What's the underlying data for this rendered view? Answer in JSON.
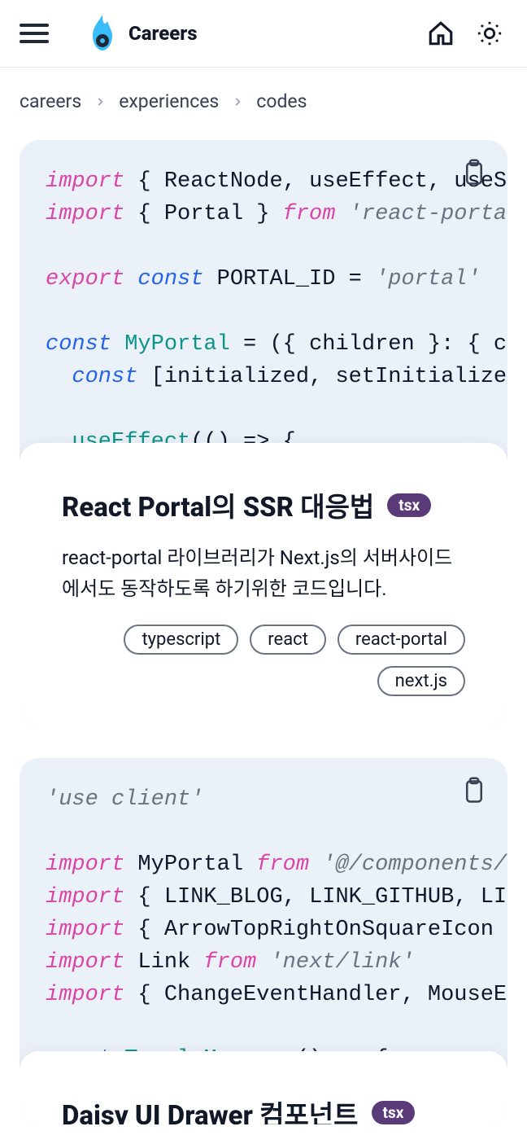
{
  "header": {
    "brand": "Careers"
  },
  "breadcrumb": {
    "items": [
      "careers",
      "experiences",
      "codes"
    ]
  },
  "cards": [
    {
      "title": "React Portal의 SSR 대응법",
      "lang_badge": "tsx",
      "description": "react-portal 라이브러리가 Next.js의 서버사이드에서도 동작하도록 하기위한 코드입니다.",
      "tags": [
        "typescript",
        "react",
        "react-portal",
        "next.js"
      ],
      "code_tokens": [
        [
          [
            "import",
            "pink"
          ],
          [
            " { ",
            "dark"
          ],
          [
            "ReactNode",
            "dark"
          ],
          [
            ", ",
            "dark"
          ],
          [
            "useEffect",
            "dark"
          ],
          [
            ", ",
            "dark"
          ],
          [
            "useS",
            "dark"
          ]
        ],
        [
          [
            "import",
            "pink"
          ],
          [
            " { ",
            "dark"
          ],
          [
            "Portal",
            "dark"
          ],
          [
            " } ",
            "dark"
          ],
          [
            "from",
            "pink"
          ],
          [
            " ",
            "dark"
          ],
          [
            "'react-porta",
            "gray"
          ]
        ],
        [],
        [
          [
            "export",
            "pink"
          ],
          [
            " ",
            "dark"
          ],
          [
            "const",
            "blue"
          ],
          [
            " ",
            "dark"
          ],
          [
            "PORTAL_ID",
            "dark"
          ],
          [
            " = ",
            "dark"
          ],
          [
            "'portal'",
            "gray"
          ]
        ],
        [],
        [
          [
            "const",
            "blue"
          ],
          [
            " ",
            "dark"
          ],
          [
            "MyPortal",
            "teal"
          ],
          [
            " = ({ ",
            "dark"
          ],
          [
            "children",
            "dark"
          ],
          [
            " }: { c",
            "dark"
          ]
        ],
        [
          [
            "  ",
            "dark"
          ],
          [
            "const",
            "blue"
          ],
          [
            " [",
            "dark"
          ],
          [
            "initialized",
            "dark"
          ],
          [
            ", ",
            "dark"
          ],
          [
            "setInitialize",
            "dark"
          ]
        ],
        [],
        [
          [
            "  ",
            "dark"
          ],
          [
            "useEffect",
            "teal"
          ],
          [
            "(() => {",
            "dark"
          ]
        ]
      ]
    },
    {
      "title": "Daisy UI Drawer 컴포넌트",
      "lang_badge": "tsx",
      "description": "",
      "tags": [],
      "code_tokens": [
        [
          [
            "'use client'",
            "gray"
          ]
        ],
        [],
        [
          [
            "import",
            "pink"
          ],
          [
            " ",
            "dark"
          ],
          [
            "MyPortal",
            "dark"
          ],
          [
            " ",
            "dark"
          ],
          [
            "from",
            "pink"
          ],
          [
            " ",
            "dark"
          ],
          [
            "'@/components/",
            "gray"
          ]
        ],
        [
          [
            "import",
            "pink"
          ],
          [
            " { ",
            "dark"
          ],
          [
            "LINK_BLOG",
            "dark"
          ],
          [
            ", ",
            "dark"
          ],
          [
            "LINK_GITHUB",
            "dark"
          ],
          [
            ", ",
            "dark"
          ],
          [
            "LI",
            "dark"
          ]
        ],
        [
          [
            "import",
            "pink"
          ],
          [
            " { ",
            "dark"
          ],
          [
            "ArrowTopRightOnSquareIcon",
            "dark"
          ]
        ],
        [
          [
            "import",
            "pink"
          ],
          [
            " ",
            "dark"
          ],
          [
            "Link",
            "dark"
          ],
          [
            " ",
            "dark"
          ],
          [
            "from",
            "pink"
          ],
          [
            " ",
            "dark"
          ],
          [
            "'next/link'",
            "gray"
          ]
        ],
        [
          [
            "import",
            "pink"
          ],
          [
            " { ",
            "dark"
          ],
          [
            "ChangeEventHandler",
            "dark"
          ],
          [
            ", ",
            "dark"
          ],
          [
            "MouseE",
            "dark"
          ]
        ],
        [],
        [
          [
            "const",
            "blue"
          ],
          [
            " ",
            "dark"
          ],
          [
            "ToggleMenu",
            "teal"
          ],
          [
            " = () => {",
            "dark"
          ]
        ]
      ]
    }
  ]
}
